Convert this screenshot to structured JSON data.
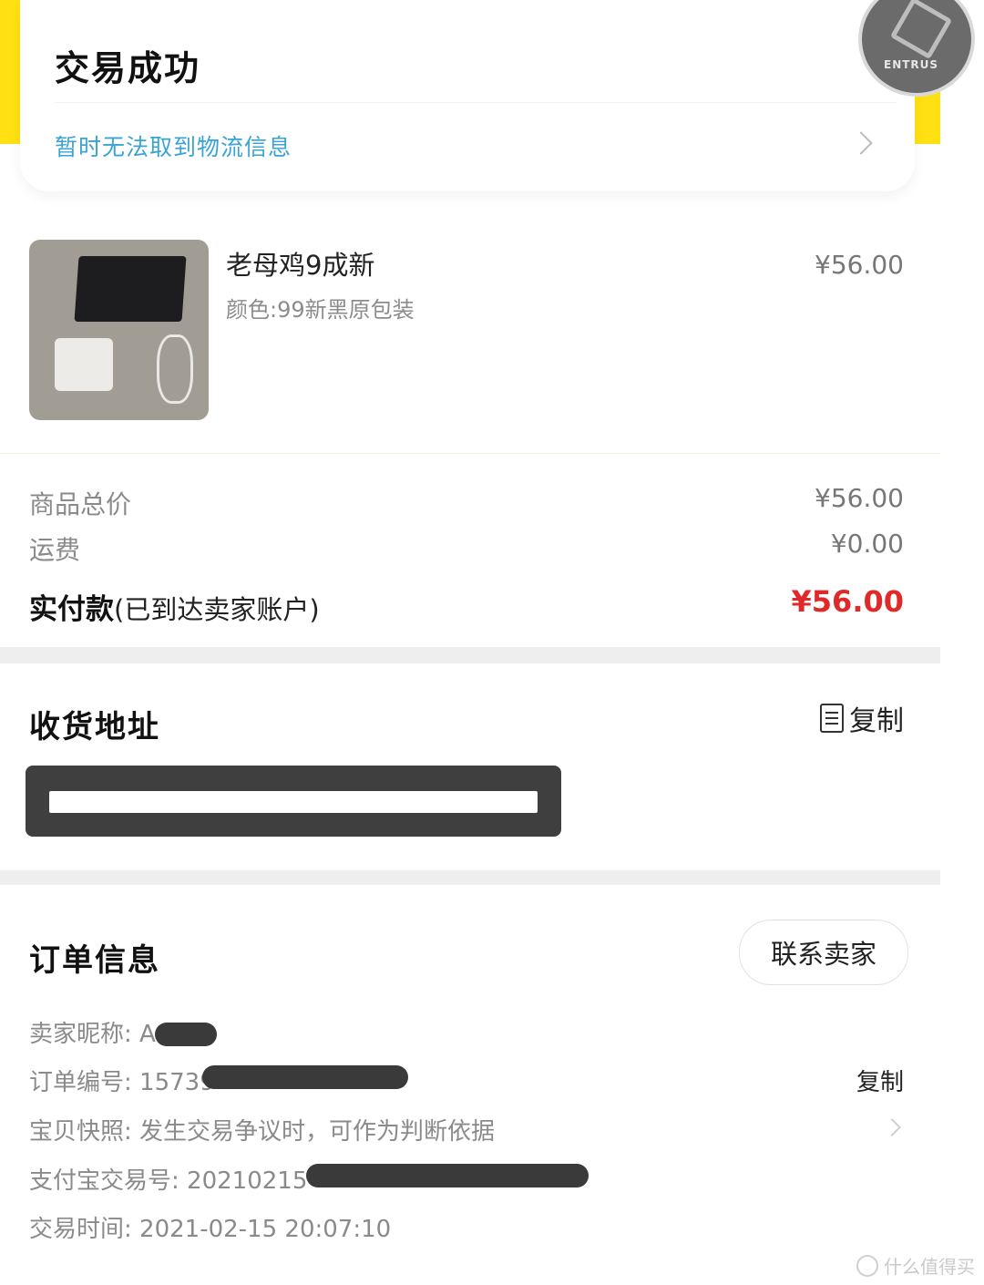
{
  "status": {
    "title": "交易成功",
    "logistics_text": "暂时无法取到物流信息",
    "badge_text": "ENTRUS"
  },
  "product": {
    "title": "老母鸡9成新",
    "spec": "颜色:99新黑原包装",
    "price": "¥56.00"
  },
  "pricing": {
    "subtotal_label": "商品总价",
    "subtotal_value": "¥56.00",
    "shipping_label": "运费",
    "shipping_value": "¥0.00",
    "paid_label": "实付款",
    "paid_note": "(已到达卖家账户)",
    "paid_value": "¥56.00"
  },
  "address": {
    "title": "收货地址",
    "copy_label": "复制"
  },
  "order": {
    "title": "订单信息",
    "contact_label": "联系卖家",
    "seller_label": "卖家昵称: ",
    "seller_value": "A",
    "order_no_label": "订单编号: ",
    "order_no_value": "15739",
    "order_copy_label": "复制",
    "snapshot_label": "宝贝快照: ",
    "snapshot_value": "发生交易争议时，可作为判断依据",
    "alipay_label": "支付宝交易号: ",
    "alipay_value": "20210215",
    "time_label": "交易时间: ",
    "time_value": "2021-02-15 20:07:10"
  },
  "watermark": "什么值得买",
  "colors": {
    "accent_yellow": "#ffe013",
    "link_blue": "#3aa3d6",
    "price_red": "#e02a2a"
  }
}
